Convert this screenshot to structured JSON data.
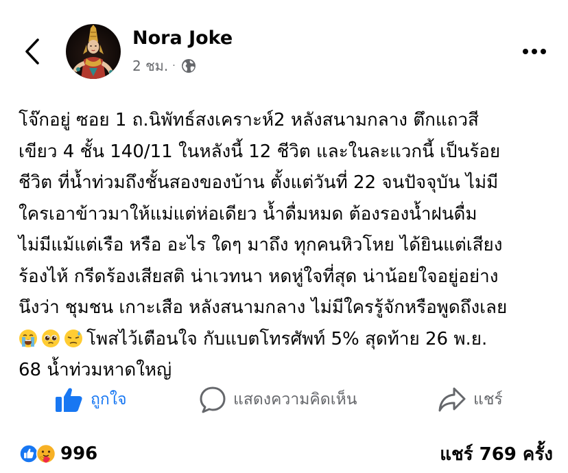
{
  "header": {
    "author_name": "Nora Joke",
    "timestamp": "2 ชม.",
    "separator": "·",
    "privacy_icon": "globe-icon",
    "back_icon": "chevron-left-icon",
    "more_icon": "more-horizontal-icon"
  },
  "post": {
    "lines": [
      "โจ๊กอยู่ ซอย 1 ถ.นิพัทธ์สงเคราะห์2 หลังสนามกลาง ตึกแถวสี",
      "เขียว 4 ชั้น 140/11 ในหลังนี้ 12 ชีวิต และในละแวกนี้ เป็นร้อย",
      "ชีวิต ที่น้ำท่วมถึงชั้นสองของบ้าน ตั้งแต่วันที่ 22 จนปัจจุบัน ไม่มี",
      "ใครเอาข้าวมาให้แม่แต่ห่อเดียว น้ำดื่มหมด ต้องรองน้ำฝนดื่ม",
      "ไม่มีแม้แต่เรือ หรือ อะไร ใดๆ มาถึง ทุกคนหิวโหย ได้ยินแต่เสียง",
      "ร้องไห้ กรีดร้องเสียสติ น่าเวทนา หดหู่ใจที่สุด น่าน้อยใจอยู่อย่าง",
      "นึงว่า ชุมชน เกาะเสือ หลังสนามกลาง ไม่มีใครรู้จักหรือพูดถึงเลย"
    ],
    "emoji_line_text": "โพสไว้เตือนใจ กับแบตโทรศัพท์ 5% สุดท้าย 26 พ.ย.",
    "last_line": "68 น้ำท่วมหาดใหญ่",
    "emojis": [
      "loudly-crying-face",
      "pleading-face",
      "downcast-face-with-sweat"
    ]
  },
  "actions": {
    "like_label": "ถูกใจ",
    "comment_label": "แสดงความคิดเห็น",
    "share_label": "แชร์",
    "like_color": "#1877f2",
    "muted_color": "#65676b"
  },
  "footer": {
    "reaction_count": "996",
    "share_count": "แชร์ 769 ครั้ง",
    "reaction_icons": [
      "like-reaction-icon",
      "care-reaction-icon"
    ]
  }
}
